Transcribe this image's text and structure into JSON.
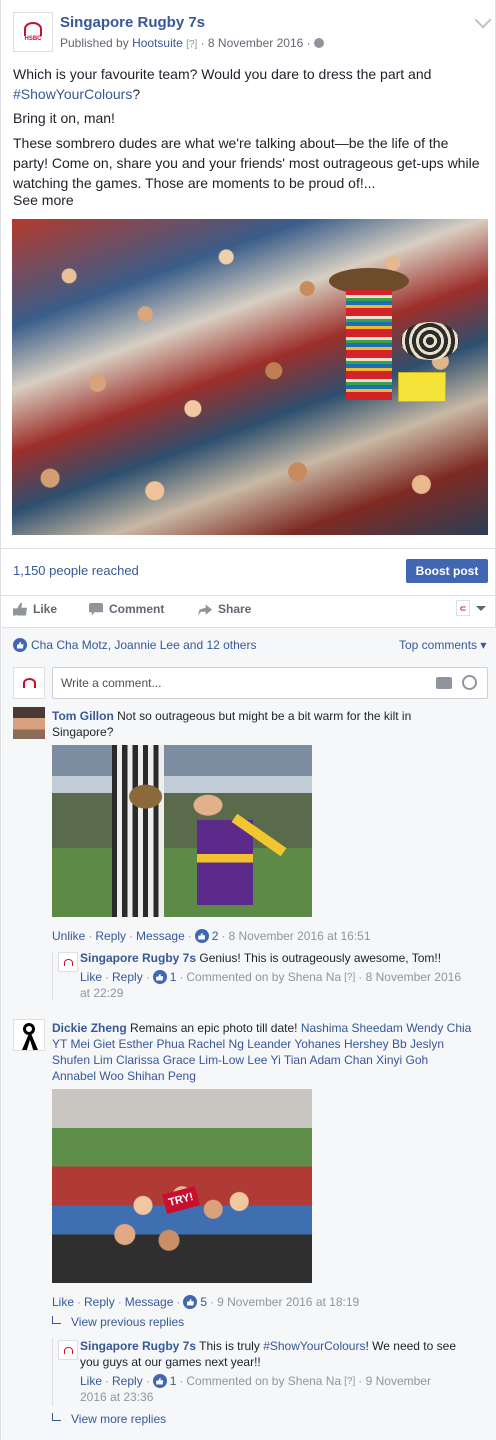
{
  "post": {
    "page_name": "Singapore Rugby 7s",
    "published_by_prefix": "Published by",
    "published_by": "Hootsuite",
    "q_mark": "[?]",
    "date_text": "· 8 November 2016 ·",
    "text_line1": "Which is your favourite team? Would you dare to dress the part and",
    "hashtag": "#ShowYourColours",
    "text_line1_end": "?",
    "text_line2": "Bring it on, man!",
    "text_line3": "These sombrero dudes are what we're talking about—be the life of the party! Come on, share you and your friends' most outrageous get-ups while watching the games. Those are moments to be proud of!...",
    "see_more": "See more"
  },
  "insights": {
    "reached": "1,150 people reached",
    "boost_label": "Boost post"
  },
  "actions": {
    "like": "Like",
    "comment": "Comment",
    "share": "Share"
  },
  "reactions": {
    "likers": "Cha Cha Motz, Joannie Lee and 12 others",
    "sort": "Top comments ▾"
  },
  "composer": {
    "placeholder": "Write a comment..."
  },
  "comments": [
    {
      "author": "Tom Gillon",
      "text": "Not so outrageous but might be a bit warm for the kilt in Singapore?",
      "unlike": "Unlike",
      "reply": "Reply",
      "message": "Message",
      "likes": "2",
      "timestamp": "8 November 2016 at 16:51",
      "reply_item": {
        "author": "Singapore Rugby 7s",
        "text": "Genius! This is outrageously awesome, Tom!!",
        "like": "Like",
        "reply": "Reply",
        "likes": "1",
        "commented_by": "Commented on by Shena Na",
        "q_mark": "[?]",
        "timestamp_a": "· 8 November 2016",
        "timestamp_b": "at 22:29"
      }
    },
    {
      "author": "Dickie Zheng",
      "text_prefix": "Remains an epic photo till date!",
      "tags_line1": "Nashima Sheedam Wendy Chia",
      "tags_line2": "YT Mei Giet Esther Phua Rachel Ng Leander Yohanes Hershey Bb Jeslyn",
      "tags_line3": "Shufen Lim Clarissa Grace Lim-Low Lee Yi Tian Adam Chan Xinyi Goh",
      "tags_line4": "Annabel Woo Shihan Peng",
      "like": "Like",
      "reply": "Reply",
      "message": "Message",
      "likes": "5",
      "timestamp": "9 November 2016 at 18:19",
      "view_previous": "View previous replies",
      "reply_item": {
        "author": "Singapore Rugby 7s",
        "text_a": "This is truly",
        "hashtag": "#ShowYourColours",
        "text_b": "! We need to see",
        "text_c": "you guys at our games next year!!",
        "like": "Like",
        "reply": "Reply",
        "likes": "1",
        "commented_by": "Commented on by Shena Na",
        "q_mark": "[?]",
        "timestamp_a": "· 9 November",
        "timestamp_b": "2016 at 23:36"
      },
      "view_more": "View more replies"
    }
  ],
  "colors": {
    "link": "#365899",
    "boost": "#4267b2",
    "brand_red": "#c8102e"
  },
  "icons": [
    "chevron-down-icon",
    "globe-icon",
    "like-icon",
    "comment-icon",
    "share-icon",
    "camera-icon",
    "emoji-icon",
    "reply-arrow-icon"
  ]
}
